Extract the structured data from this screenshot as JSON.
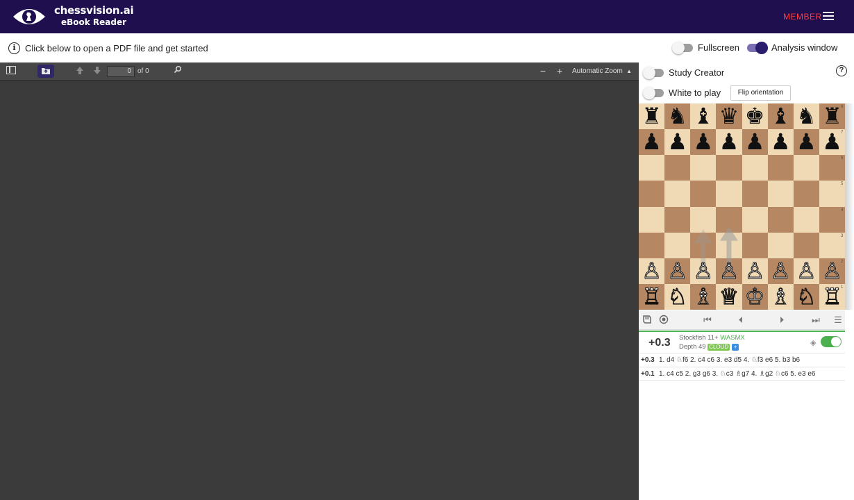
{
  "header": {
    "brand_title": "chessvision.ai",
    "brand_subtitle": "eBook Reader",
    "member_label": "MEMBER"
  },
  "infobar": {
    "message": "Click below to open a PDF file and get started",
    "fullscreen_label": "Fullscreen",
    "analysis_window_label": "Analysis window"
  },
  "pdf_viewer": {
    "page_number": "0",
    "page_of": "of 0",
    "zoom": "Automatic Zoom"
  },
  "panel": {
    "study_creator_label": "Study Creator",
    "white_to_play_label": "White to play",
    "flip_button": "Flip orientation"
  },
  "board": {
    "ranks": [
      "8",
      "7",
      "6",
      "5",
      "4",
      "3",
      "2",
      "1"
    ],
    "black_back": [
      "♜",
      "♞",
      "♝",
      "♛",
      "♚",
      "♝",
      "♞",
      "♜"
    ],
    "black_pawns": [
      "♟",
      "♟",
      "♟",
      "♟",
      "♟",
      "♟",
      "♟",
      "♟"
    ],
    "white_pawns": [
      "♙",
      "♙",
      "♙",
      "♙",
      "♙",
      "♙",
      "♙",
      "♙"
    ],
    "white_back": [
      "♖",
      "♘",
      "♗",
      "♕",
      "♔",
      "♗",
      "♘",
      "♖"
    ]
  },
  "engine": {
    "eval": "+0.3",
    "name": "Stockfish 11+",
    "tag": "WASMX",
    "depth": "Depth 49",
    "cloud": "CLOUD",
    "plus": "+"
  },
  "lines": [
    {
      "eval": "+0.3",
      "moves": "1. d4 ♘f6 2. c4 c6 3. e3 d5 4. ♘f3 e6 5. b3 b6"
    },
    {
      "eval": "+0.1",
      "moves": "1. c4 c5 2. g3 g6 3. ♘c3 ♗g7 4. ♗g2 ♘c6 5. e3 e6"
    }
  ],
  "icons": {
    "info": "info-icon",
    "help": "help-icon",
    "menu": "hamburger-icon"
  },
  "colors": {
    "header_bg": "#1f0f4f",
    "member": "#ff3b3b",
    "pdf_bg": "#3b3b3b",
    "light_square": "#f0d9b5",
    "dark_square": "#b58863",
    "engine_green": "#4caf50"
  }
}
